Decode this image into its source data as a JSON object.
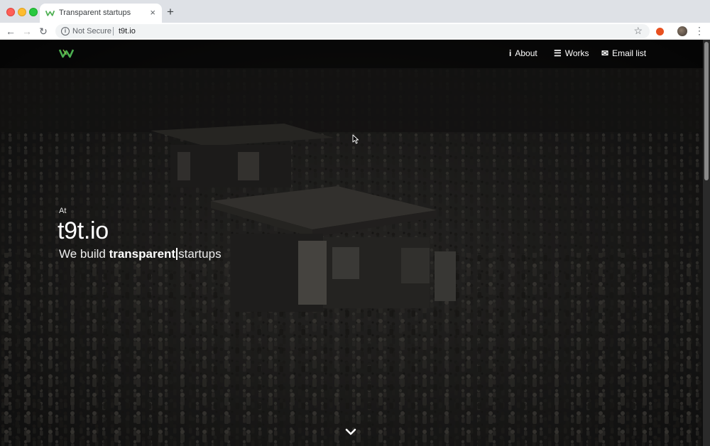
{
  "browser": {
    "tab_title": "Transparent startups",
    "tab_close": "×",
    "new_tab": "+",
    "security_label": "Not Secure",
    "url": "t9t.io",
    "info_icon": "i",
    "star_icon": "☆",
    "menu_icon": "⋮",
    "back_icon": "←",
    "forward_icon": "→",
    "reload_icon": "↻"
  },
  "nav": {
    "logo": "w-logo",
    "links": [
      {
        "icon": "info-icon",
        "glyph": "i",
        "label": "About"
      },
      {
        "icon": "grid-list-icon",
        "glyph": "☰",
        "label": "Works"
      },
      {
        "icon": "envelope-icon",
        "glyph": "✉",
        "label": "Email list"
      }
    ]
  },
  "hero": {
    "eyebrow": "At",
    "title": "t9t.io",
    "subtitle_prefix": "We build ",
    "subtitle_bold": "transparent",
    "subtitle_suffix": "startups"
  },
  "colors": {
    "accent": "#4caf50",
    "overlay": "#000000"
  }
}
